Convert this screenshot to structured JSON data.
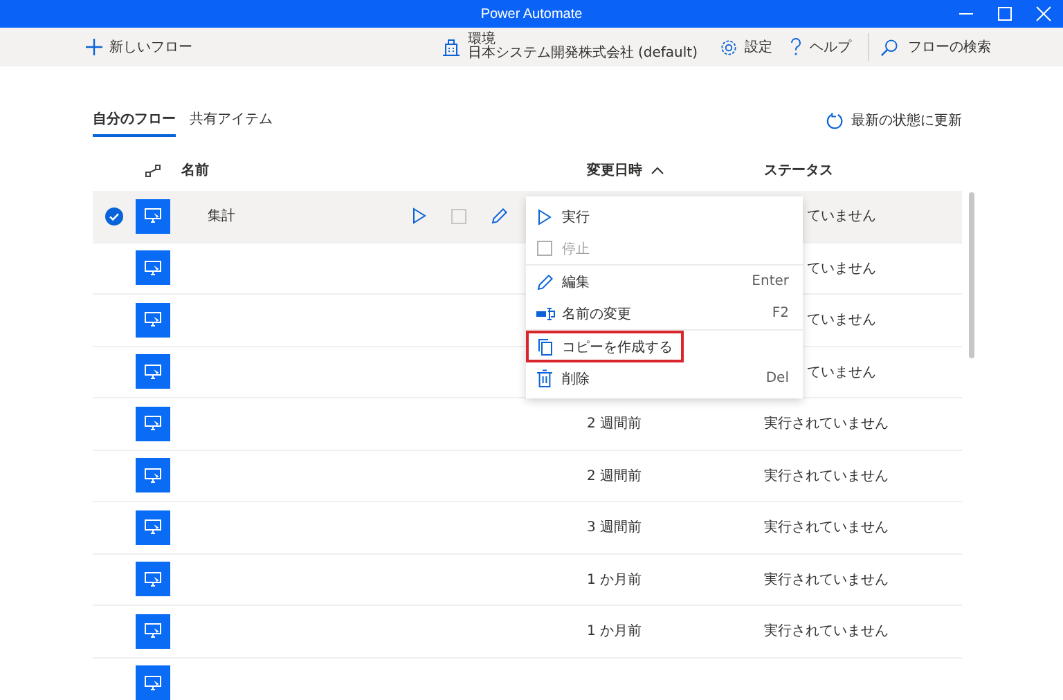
{
  "window": {
    "title": "Power Automate"
  },
  "toolbar": {
    "new_flow": "新しいフロー",
    "environment_label": "環境",
    "environment": "日本システム開発株式会社 (default)",
    "settings": "設定",
    "help": "ヘルプ",
    "search": {
      "placeholder": "フローの検索"
    }
  },
  "tabs": [
    {
      "label": "自分のフロー",
      "selected": true
    },
    {
      "label": "共有アイテム",
      "selected": false
    }
  ],
  "refresh": "最新の状態に更新",
  "table": {
    "columns": [
      "名前",
      "変更日時",
      "ステータス"
    ],
    "rows": [
      {
        "name": "集計",
        "modified": "",
        "status": "ていません",
        "selected": true
      },
      {
        "name": "",
        "modified": "",
        "status": "ていません",
        "selected": false
      },
      {
        "name": "",
        "modified": "",
        "status": "ていません",
        "selected": false
      },
      {
        "name": "",
        "modified": "",
        "status": "ていません",
        "selected": false
      },
      {
        "name": "",
        "modified": "2 週間前",
        "status": "実行されていません",
        "selected": false
      },
      {
        "name": "",
        "modified": "2 週間前",
        "status": "実行されていません",
        "selected": false
      },
      {
        "name": "",
        "modified": "3 週間前",
        "status": "実行されていません",
        "selected": false
      },
      {
        "name": "",
        "modified": "1 か月前",
        "status": "実行されていません",
        "selected": false
      },
      {
        "name": "",
        "modified": "1 か月前",
        "status": "実行されていません",
        "selected": false
      },
      {
        "name": "",
        "modified": "",
        "status": "",
        "selected": false
      }
    ]
  },
  "context_menu": [
    {
      "kind": "run",
      "label": "実行",
      "disabled": false,
      "highlighted": false
    },
    {
      "kind": "stop",
      "label": "停止",
      "disabled": true,
      "highlighted": false
    },
    {
      "kind": "edit",
      "label": "編集",
      "shortcut": "Enter",
      "disabled": false,
      "highlighted": false
    },
    {
      "kind": "rename",
      "label": "名前の変更",
      "shortcut": "F2",
      "disabled": false,
      "highlighted": false
    },
    {
      "kind": "copy",
      "label": "コピーを作成する",
      "disabled": false,
      "highlighted": true
    },
    {
      "kind": "delete",
      "label": "削除",
      "shortcut": "Del",
      "disabled": false,
      "highlighted": false
    }
  ]
}
